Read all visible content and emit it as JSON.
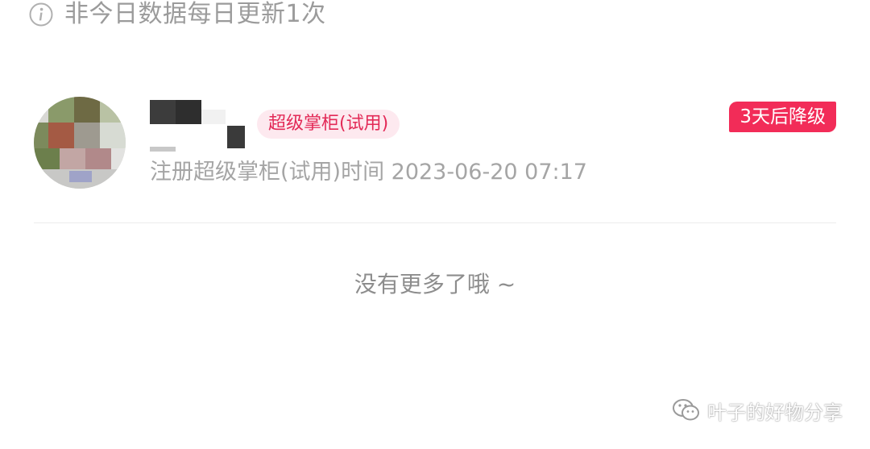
{
  "notice": {
    "icon": "info-circle-icon",
    "text": "非今日数据每日更新1次"
  },
  "member": {
    "role_badge": "超级掌柜(试用)",
    "downgrade_badge": "3天后降级",
    "register_time": "注册超级掌柜(试用)时间 2023-06-20 07:17"
  },
  "list_end_text": "没有更多了哦 ~",
  "watermark": {
    "icon": "wechat-icon",
    "text": "叶子的好物分享"
  },
  "colors": {
    "badge_accent": "#f22c58",
    "badge_soft_bg": "#fde9ef",
    "muted_text": "#9b9b9b"
  }
}
